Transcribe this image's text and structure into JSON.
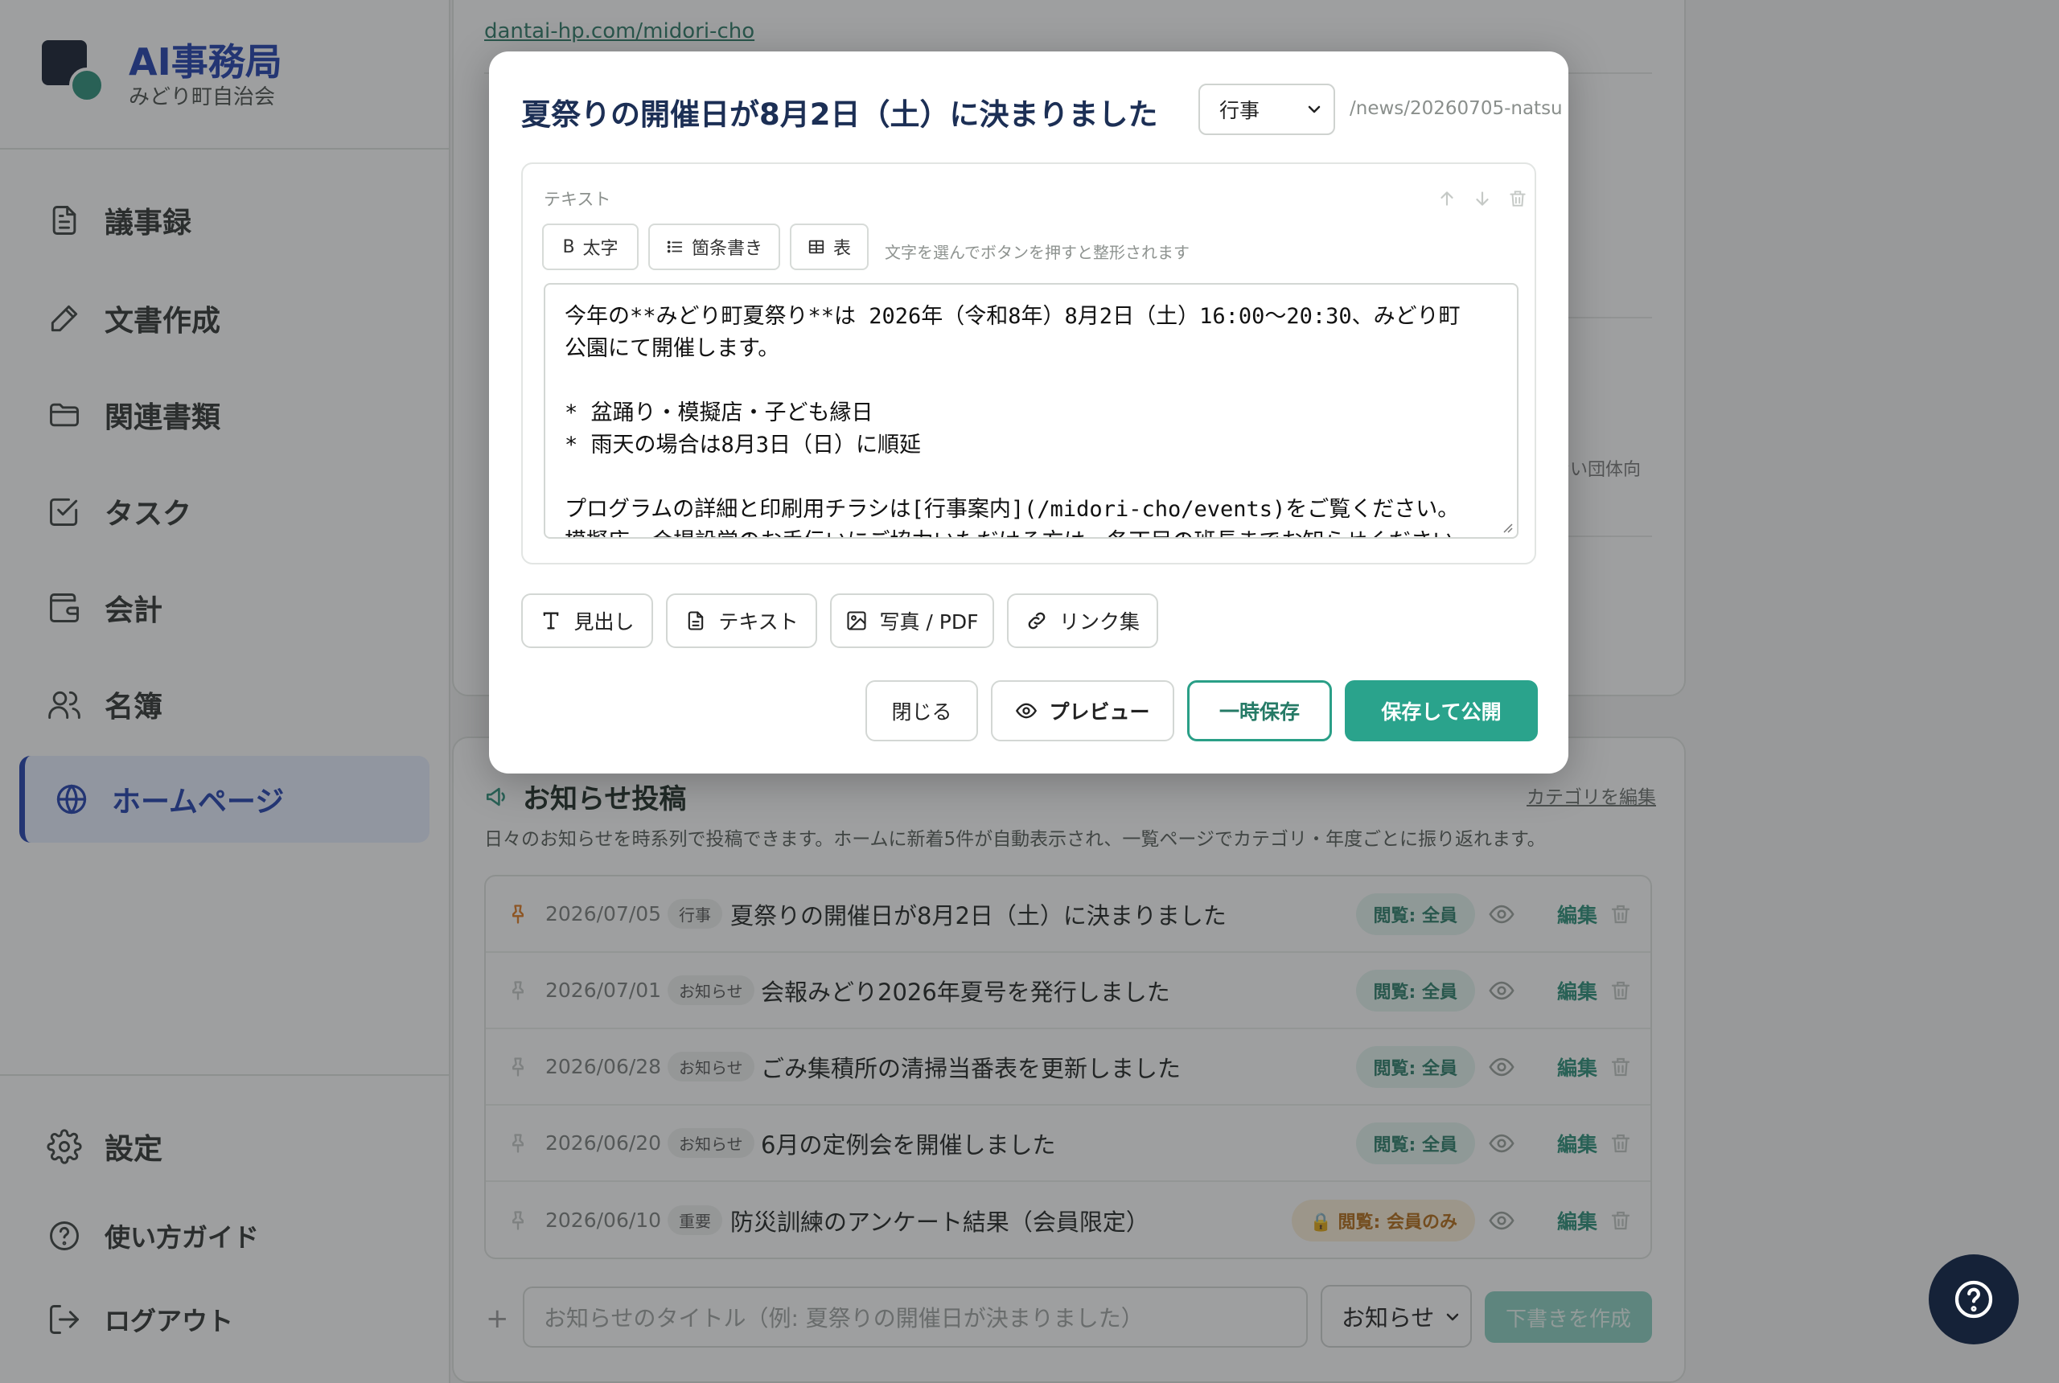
{
  "brand": {
    "title": "AI事務局",
    "subtitle": "みどり町自治会"
  },
  "sidebar": {
    "items": [
      {
        "label": "議事録",
        "icon": "document-icon"
      },
      {
        "label": "文書作成",
        "icon": "pen-icon"
      },
      {
        "label": "関連書類",
        "icon": "folder-icon"
      },
      {
        "label": "タスク",
        "icon": "checkbox-icon"
      },
      {
        "label": "会計",
        "icon": "wallet-icon"
      },
      {
        "label": "名簿",
        "icon": "users-icon"
      },
      {
        "label": "ホームページ",
        "icon": "globe-icon",
        "active": true
      }
    ],
    "bottom": [
      {
        "label": "設定",
        "icon": "gear-icon"
      },
      {
        "label": "使い方ガイド",
        "icon": "help-icon"
      },
      {
        "label": "ログアウト",
        "icon": "logout-icon"
      }
    ]
  },
  "background": {
    "site_link": "dantai-hp.com/midori-cho",
    "side_fragment": "ない団体向"
  },
  "news": {
    "title": "お知らせ投稿",
    "edit_category": "カテゴリを編集",
    "description": "日々のお知らせを時系列で投稿できます。ホームに新着5件が自動表示され、一覧ページでカテゴリ・年度ごとに振り返れます。",
    "rows": [
      {
        "date": "2026/07/05",
        "category": "行事",
        "title": "夏祭りの開催日が8月2日（土）に決まりました",
        "visibility": "閲覧: 全員",
        "pinned": true
      },
      {
        "date": "2026/07/01",
        "category": "お知らせ",
        "title": "会報みどり2026年夏号を発行しました",
        "visibility": "閲覧: 全員",
        "pinned": false
      },
      {
        "date": "2026/06/28",
        "category": "お知らせ",
        "title": "ごみ集積所の清掃当番表を更新しました",
        "visibility": "閲覧: 全員",
        "pinned": false
      },
      {
        "date": "2026/06/20",
        "category": "お知らせ",
        "title": "6月の定例会を開催しました",
        "visibility": "閲覧: 全員",
        "pinned": false
      },
      {
        "date": "2026/06/10",
        "category": "重要",
        "title": "防災訓練のアンケート結果（会員限定）",
        "visibility": "閲覧: 会員のみ",
        "pinned": false,
        "members_only": true
      }
    ],
    "edit_label": "編集",
    "compose": {
      "placeholder": "お知らせのタイトル（例: 夏祭りの開催日が決まりました）",
      "category": "お知らせ",
      "create_label": "下書きを作成"
    }
  },
  "modal": {
    "title": "夏祭りの開催日が8月2日（土）に決まりました",
    "category": "行事",
    "slug": "/news/20260705-natsu",
    "block_label": "テキスト",
    "format_buttons": {
      "bold": "太字",
      "list": "箇条書き",
      "table": "表"
    },
    "format_hint": "文字を選んでボタンを押すと整形されます",
    "body_lines": [
      "今年の**みどり町夏祭り**は 2026年（令和8年）8月2日（土）16:00〜20:30、みどり町",
      "公園にて開催します。",
      "",
      "* 盆踊り・模擬店・子ども縁日",
      "* 雨天の場合は8月3日（日）に順延",
      "",
      "プログラムの詳細と印刷用チラシは[行事案内](/midori-cho/events)をご覧ください。",
      "模擬店・会場設営のお手伝いにご協力いただける方は、各丁目の班長までお知らせください。"
    ],
    "add_buttons": {
      "heading": "見出し",
      "text": "テキスト",
      "photo": "写真 / PDF",
      "links": "リンク集"
    },
    "actions": {
      "close": "閉じる",
      "preview": "プレビュー",
      "temp_save": "一時保存",
      "publish": "保存して公開"
    }
  },
  "colors": {
    "brand": "#1f3fae",
    "accent": "#2aa38c",
    "navy": "#152238"
  }
}
